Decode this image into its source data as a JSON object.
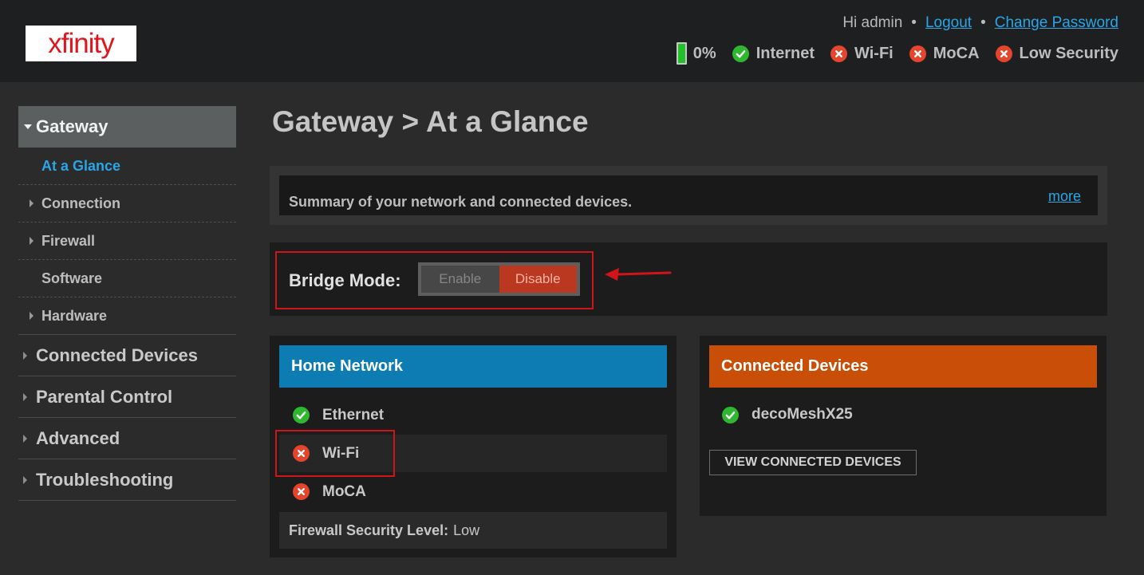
{
  "header": {
    "logo_text": "xfinity",
    "greeting": "Hi admin",
    "logout": "Logout",
    "change_password": "Change Password",
    "separator": "•",
    "battery": {
      "level": 0,
      "label": "0%"
    },
    "status": [
      {
        "label": "Internet",
        "state": "ok",
        "icon": "check-icon"
      },
      {
        "label": "Wi-Fi",
        "state": "error",
        "icon": "x-icon"
      },
      {
        "label": "MoCA",
        "state": "error",
        "icon": "x-icon"
      },
      {
        "label": "Low Security",
        "state": "error",
        "icon": "x-icon"
      }
    ]
  },
  "sidebar": {
    "top": "Gateway",
    "subitems": [
      {
        "label": "At a Glance",
        "active": true,
        "arrow": false
      },
      {
        "label": "Connection",
        "active": false,
        "arrow": true
      },
      {
        "label": "Firewall",
        "active": false,
        "arrow": true
      },
      {
        "label": "Software",
        "active": false,
        "arrow": false
      },
      {
        "label": "Hardware",
        "active": false,
        "arrow": true
      }
    ],
    "items": [
      "Connected Devices",
      "Parental Control",
      "Advanced",
      "Troubleshooting"
    ]
  },
  "main": {
    "title": "Gateway > At a Glance",
    "summary": "Summary of your network and connected devices.",
    "more": "more",
    "bridge": {
      "label": "Bridge Mode:",
      "enable": "Enable",
      "disable": "Disable",
      "selected": "Disable"
    }
  },
  "home_network": {
    "title": "Home Network",
    "items": [
      {
        "label": "Ethernet",
        "state": "ok"
      },
      {
        "label": "Wi-Fi",
        "state": "error"
      },
      {
        "label": "MoCA",
        "state": "error"
      }
    ],
    "firewall_label": "Firewall Security Level:",
    "firewall_value": "Low"
  },
  "connected_devices": {
    "title": "Connected Devices",
    "device": "decoMeshX25",
    "device_state": "ok",
    "button": "VIEW CONNECTED DEVICES"
  },
  "colors": {
    "accent_blue": "#2aa6e6",
    "home_header": "#0d7cb3",
    "devices_header": "#c94e07",
    "ok": "#2fb82f",
    "error": "#e5452d",
    "annotation_red": "#d0141a"
  }
}
